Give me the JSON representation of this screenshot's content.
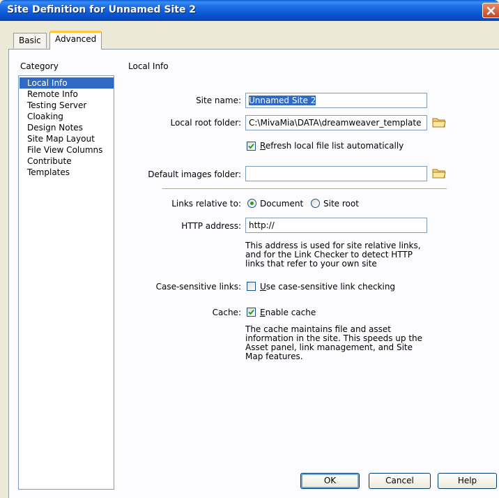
{
  "window": {
    "title": "Site Definition for Unnamed Site 2"
  },
  "tabs": [
    {
      "label": "Basic",
      "active": false
    },
    {
      "label": "Advanced",
      "active": true
    }
  ],
  "category": {
    "heading": "Category",
    "items": [
      {
        "label": "Local Info",
        "selected": true
      },
      {
        "label": "Remote Info",
        "selected": false
      },
      {
        "label": "Testing Server",
        "selected": false
      },
      {
        "label": "Cloaking",
        "selected": false
      },
      {
        "label": "Design Notes",
        "selected": false
      },
      {
        "label": "Site Map Layout",
        "selected": false
      },
      {
        "label": "File View Columns",
        "selected": false
      },
      {
        "label": "Contribute",
        "selected": false
      },
      {
        "label": "Templates",
        "selected": false
      }
    ]
  },
  "local_info": {
    "section_title": "Local Info",
    "site_name_label": "Site name:",
    "site_name_value": "Unnamed Site 2",
    "local_root_label": "Local root folder:",
    "local_root_value": "C:\\MivaMia\\DATA\\dreamweaver_template",
    "refresh_checked": true,
    "refresh_label_access": "R",
    "refresh_label_rest": "efresh local file list automatically",
    "default_images_label": "Default images folder:",
    "default_images_value": "",
    "links_relative_label": "Links relative to:",
    "radio_document_label": "Document",
    "radio_site_root_label": "Site root",
    "links_relative_selected": "Document",
    "http_label": "HTTP address:",
    "http_value": "http://",
    "http_help": "This address is used for site relative links, and for the Link Checker to detect HTTP links that refer to your own site",
    "case_label": "Case-sensitive links:",
    "case_checked": false,
    "case_check_access": "U",
    "case_check_rest": "se case-sensitive link checking",
    "cache_label": "Cache:",
    "cache_checked": true,
    "cache_check_access": "E",
    "cache_check_rest": "nable cache",
    "cache_help": "The cache maintains file and asset information in the site.  This speeds up the Asset panel, link management, and Site Map features."
  },
  "buttons": {
    "ok": "OK",
    "cancel": "Cancel",
    "help": "Help"
  },
  "colors": {
    "titlebar": "#0a55d0",
    "selection": "#316ac5",
    "dialog_bg": "#ece9d8",
    "close": "#c9451f"
  },
  "icons": {
    "close": "close-icon",
    "folder": "folder-icon",
    "check": "checkmark-icon"
  }
}
